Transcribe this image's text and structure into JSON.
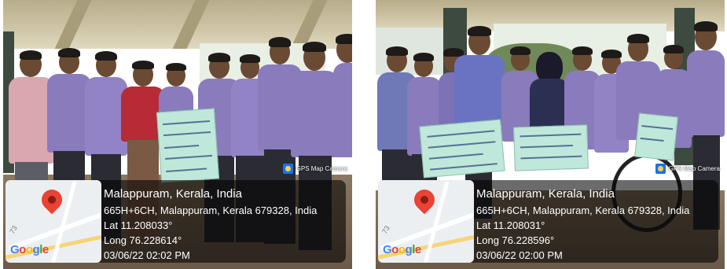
{
  "photos": [
    {
      "place": "Malappuram, Kerala, India",
      "address": "665H+6CH, Malappuram, Kerala 679328, India",
      "lat": "Lat 11.208033°",
      "long": "Long 76.228614°",
      "datetime": "03/06/22 02:02 PM",
      "watermark": "GPS Map Camera",
      "map_road_number": "73"
    },
    {
      "place": "Malappuram, Kerala, India",
      "address": "665H+6CH, Malappuram, Kerala 679328, India",
      "lat": "Lat 11.208031°",
      "long": "Long 76.228596°",
      "datetime": "03/06/22 02:00 PM",
      "watermark": "GPS Map Camera",
      "map_road_number": "73"
    }
  ],
  "icons": [
    "map-pin-icon",
    "gps-camera-icon"
  ],
  "colors": {
    "uniform_shirt": "#8a7bbd",
    "sign_paper": "#bfe8da",
    "map_pin": "#ea4335",
    "overlay": "rgba(0,0,0,0.58)"
  }
}
